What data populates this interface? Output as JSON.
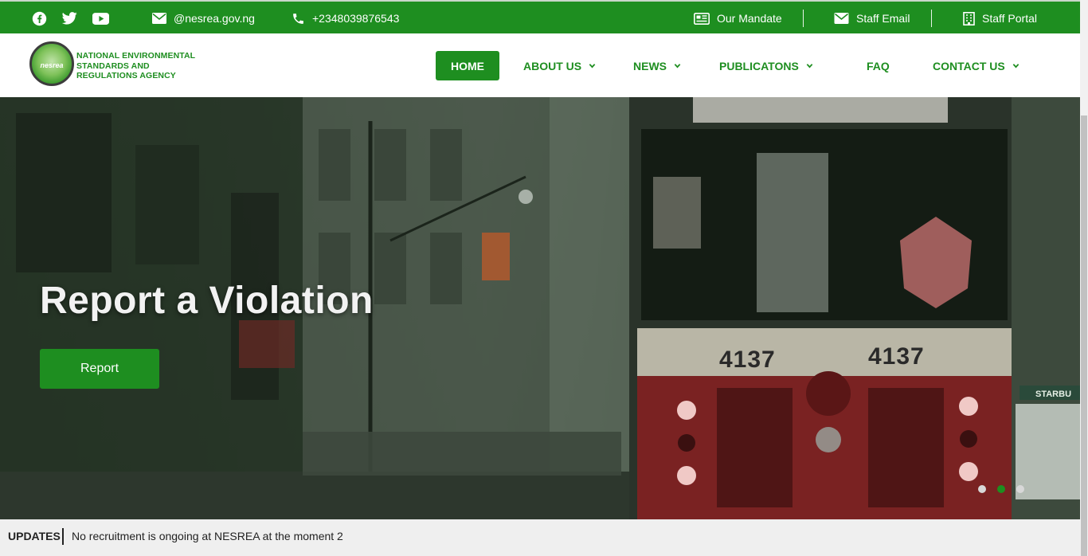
{
  "topbar": {
    "email": "@nesrea.gov.ng",
    "phone": "+2348039876543",
    "mandate": "Our Mandate",
    "staff_email": "Staff Email",
    "staff_portal": "Staff Portal",
    "bg_color": "#1e8e20",
    "social_icons": [
      "facebook-icon",
      "twitter-icon",
      "youtube-icon"
    ]
  },
  "header": {
    "logo_text": "nesrea",
    "agency_line1": "NATIONAL ENVIRONMENTAL",
    "agency_line2": "STANDARDS AND",
    "agency_line3": "REGULATIONS AGENCY",
    "nav": {
      "home": "HOME",
      "about": "ABOUT US",
      "news": "NEWS",
      "publications": "PUBLICATONS",
      "faq": "FAQ",
      "contact": "CONTACT US"
    },
    "accent_color": "#1e8e20"
  },
  "hero": {
    "title": "Report a Violation",
    "button": "Report",
    "tram_numbers": [
      "4137",
      "4137"
    ],
    "slides": 3,
    "active_slide": 2
  },
  "updates": {
    "label": "UPDATES",
    "message": "No recruitment is ongoing at NESREA at the moment 2"
  }
}
